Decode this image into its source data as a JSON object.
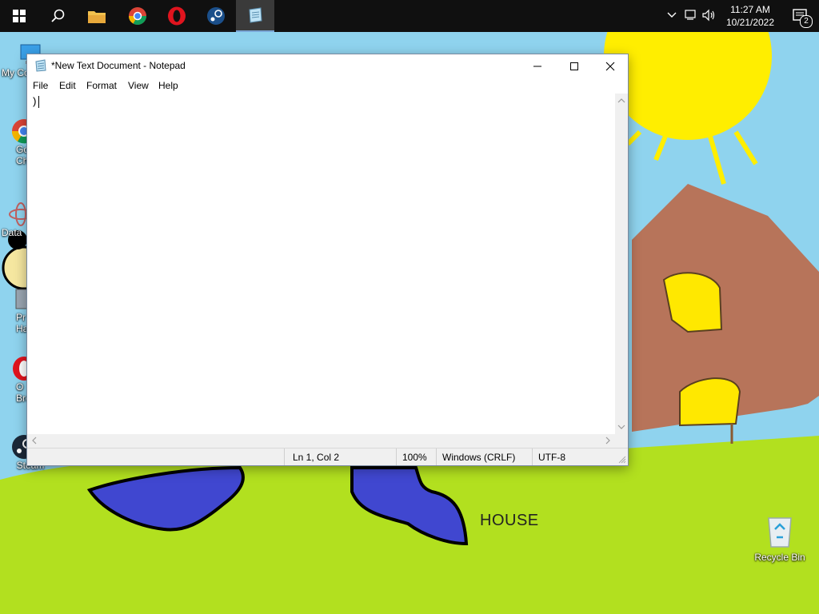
{
  "taskbar": {
    "apps": [
      {
        "name": "start-icon"
      },
      {
        "name": "search-icon"
      },
      {
        "name": "file-explorer-icon"
      },
      {
        "name": "chrome-icon"
      },
      {
        "name": "opera-icon"
      },
      {
        "name": "steam-icon"
      },
      {
        "name": "notepad-icon",
        "active": true
      }
    ],
    "clock": {
      "time": "11:27 AM",
      "date": "10/21/2022"
    },
    "notification_count": "2"
  },
  "desktop": {
    "icons": [
      {
        "label": "My Co"
      },
      {
        "label": "Go\nCh"
      },
      {
        "label": "Data"
      },
      {
        "label": "Pr\nHa"
      },
      {
        "label": "O\nBro"
      },
      {
        "label": "Steam"
      },
      {
        "label": "Recycle Bin"
      }
    ],
    "drawing_label": "HOUSE"
  },
  "notepad": {
    "title": "*New Text Document - Notepad",
    "menu": [
      "File",
      "Edit",
      "Format",
      "View",
      "Help"
    ],
    "content": ")",
    "status": {
      "position": "Ln 1, Col 2",
      "zoom": "100%",
      "line_ending": "Windows (CRLF)",
      "encoding": "UTF-8"
    }
  },
  "colors": {
    "sky": "#8fd3ee",
    "grass": "#b2e01f",
    "sun": "#ffee00",
    "house": "#b7745a",
    "window": "#ffe800",
    "pants": "#4047d0"
  }
}
